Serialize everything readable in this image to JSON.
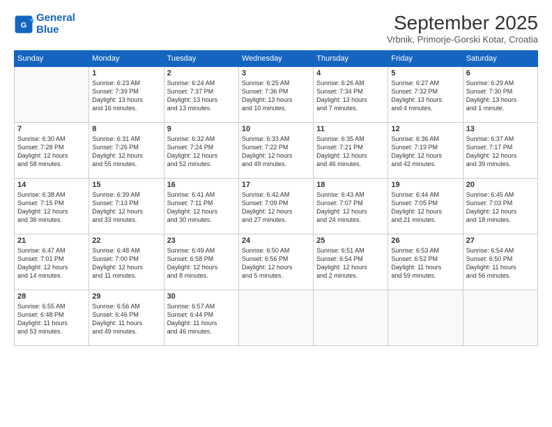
{
  "logo": {
    "line1": "General",
    "line2": "Blue"
  },
  "title": "September 2025",
  "subtitle": "Vrbnik, Primorje-Gorski Kotar, Croatia",
  "days_of_week": [
    "Sunday",
    "Monday",
    "Tuesday",
    "Wednesday",
    "Thursday",
    "Friday",
    "Saturday"
  ],
  "weeks": [
    [
      {
        "day": "",
        "info": ""
      },
      {
        "day": "1",
        "info": "Sunrise: 6:23 AM\nSunset: 7:39 PM\nDaylight: 13 hours\nand 16 minutes."
      },
      {
        "day": "2",
        "info": "Sunrise: 6:24 AM\nSunset: 7:37 PM\nDaylight: 13 hours\nand 13 minutes."
      },
      {
        "day": "3",
        "info": "Sunrise: 6:25 AM\nSunset: 7:36 PM\nDaylight: 13 hours\nand 10 minutes."
      },
      {
        "day": "4",
        "info": "Sunrise: 6:26 AM\nSunset: 7:34 PM\nDaylight: 13 hours\nand 7 minutes."
      },
      {
        "day": "5",
        "info": "Sunrise: 6:27 AM\nSunset: 7:32 PM\nDaylight: 13 hours\nand 4 minutes."
      },
      {
        "day": "6",
        "info": "Sunrise: 6:29 AM\nSunset: 7:30 PM\nDaylight: 13 hours\nand 1 minute."
      }
    ],
    [
      {
        "day": "7",
        "info": "Sunrise: 6:30 AM\nSunset: 7:28 PM\nDaylight: 12 hours\nand 58 minutes."
      },
      {
        "day": "8",
        "info": "Sunrise: 6:31 AM\nSunset: 7:26 PM\nDaylight: 12 hours\nand 55 minutes."
      },
      {
        "day": "9",
        "info": "Sunrise: 6:32 AM\nSunset: 7:24 PM\nDaylight: 12 hours\nand 52 minutes."
      },
      {
        "day": "10",
        "info": "Sunrise: 6:33 AM\nSunset: 7:22 PM\nDaylight: 12 hours\nand 49 minutes."
      },
      {
        "day": "11",
        "info": "Sunrise: 6:35 AM\nSunset: 7:21 PM\nDaylight: 12 hours\nand 46 minutes."
      },
      {
        "day": "12",
        "info": "Sunrise: 6:36 AM\nSunset: 7:19 PM\nDaylight: 12 hours\nand 42 minutes."
      },
      {
        "day": "13",
        "info": "Sunrise: 6:37 AM\nSunset: 7:17 PM\nDaylight: 12 hours\nand 39 minutes."
      }
    ],
    [
      {
        "day": "14",
        "info": "Sunrise: 6:38 AM\nSunset: 7:15 PM\nDaylight: 12 hours\nand 36 minutes."
      },
      {
        "day": "15",
        "info": "Sunrise: 6:39 AM\nSunset: 7:13 PM\nDaylight: 12 hours\nand 33 minutes."
      },
      {
        "day": "16",
        "info": "Sunrise: 6:41 AM\nSunset: 7:11 PM\nDaylight: 12 hours\nand 30 minutes."
      },
      {
        "day": "17",
        "info": "Sunrise: 6:42 AM\nSunset: 7:09 PM\nDaylight: 12 hours\nand 27 minutes."
      },
      {
        "day": "18",
        "info": "Sunrise: 6:43 AM\nSunset: 7:07 PM\nDaylight: 12 hours\nand 24 minutes."
      },
      {
        "day": "19",
        "info": "Sunrise: 6:44 AM\nSunset: 7:05 PM\nDaylight: 12 hours\nand 21 minutes."
      },
      {
        "day": "20",
        "info": "Sunrise: 6:45 AM\nSunset: 7:03 PM\nDaylight: 12 hours\nand 18 minutes."
      }
    ],
    [
      {
        "day": "21",
        "info": "Sunrise: 6:47 AM\nSunset: 7:01 PM\nDaylight: 12 hours\nand 14 minutes."
      },
      {
        "day": "22",
        "info": "Sunrise: 6:48 AM\nSunset: 7:00 PM\nDaylight: 12 hours\nand 11 minutes."
      },
      {
        "day": "23",
        "info": "Sunrise: 6:49 AM\nSunset: 6:58 PM\nDaylight: 12 hours\nand 8 minutes."
      },
      {
        "day": "24",
        "info": "Sunrise: 6:50 AM\nSunset: 6:56 PM\nDaylight: 12 hours\nand 5 minutes."
      },
      {
        "day": "25",
        "info": "Sunrise: 6:51 AM\nSunset: 6:54 PM\nDaylight: 12 hours\nand 2 minutes."
      },
      {
        "day": "26",
        "info": "Sunrise: 6:53 AM\nSunset: 6:52 PM\nDaylight: 11 hours\nand 59 minutes."
      },
      {
        "day": "27",
        "info": "Sunrise: 6:54 AM\nSunset: 6:50 PM\nDaylight: 11 hours\nand 56 minutes."
      }
    ],
    [
      {
        "day": "28",
        "info": "Sunrise: 6:55 AM\nSunset: 6:48 PM\nDaylight: 11 hours\nand 53 minutes."
      },
      {
        "day": "29",
        "info": "Sunrise: 6:56 AM\nSunset: 6:46 PM\nDaylight: 11 hours\nand 49 minutes."
      },
      {
        "day": "30",
        "info": "Sunrise: 6:57 AM\nSunset: 6:44 PM\nDaylight: 11 hours\nand 46 minutes."
      },
      {
        "day": "",
        "info": ""
      },
      {
        "day": "",
        "info": ""
      },
      {
        "day": "",
        "info": ""
      },
      {
        "day": "",
        "info": ""
      }
    ]
  ]
}
